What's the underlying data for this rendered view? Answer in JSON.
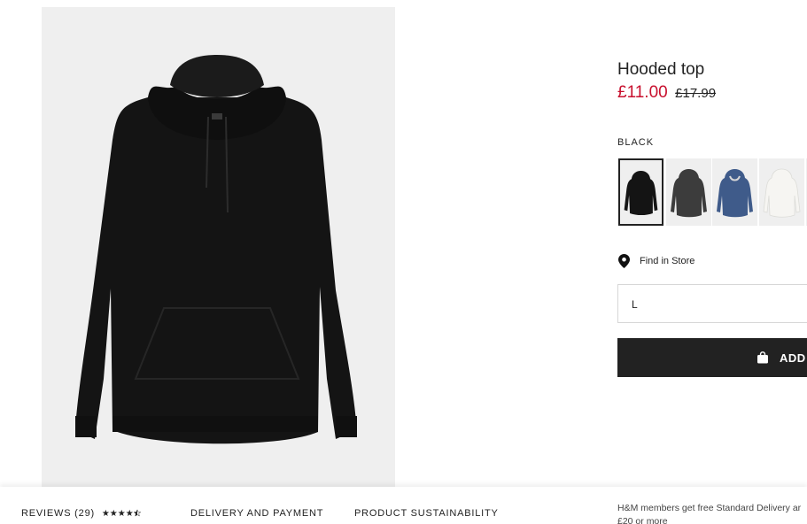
{
  "product": {
    "title": "Hooded top",
    "sale_price": "£11.00",
    "original_price": "£17.99",
    "image_icon": "black-hoodie-image"
  },
  "colors": {
    "selected_label": "BLACK",
    "swatches": [
      {
        "name": "black",
        "color": "#141414"
      },
      {
        "name": "dark-grey",
        "color": "#3c3c3c"
      },
      {
        "name": "blue",
        "color": "#3f5b8a"
      },
      {
        "name": "white",
        "color": "#ededea"
      }
    ]
  },
  "store": {
    "find_label": "Find in Store",
    "icon": "location-pin-icon"
  },
  "size": {
    "selected_value": "L"
  },
  "cart": {
    "add_label": "ADD",
    "icon": "shopping-bag-icon"
  },
  "bottom_bar": {
    "reviews_label": "REVIEWS (29)",
    "stars": "★★★★",
    "rating_value": 4.5,
    "delivery_label": "DELIVERY AND PAYMENT",
    "sustainability_label": "PRODUCT SUSTAINABILITY",
    "promo_line1": "H&M members get free Standard Delivery ar",
    "promo_line2": "£20 or more"
  },
  "theme": {
    "sale_color": "#c8102e",
    "button_color": "#222222",
    "image_bg": "#efefef"
  }
}
